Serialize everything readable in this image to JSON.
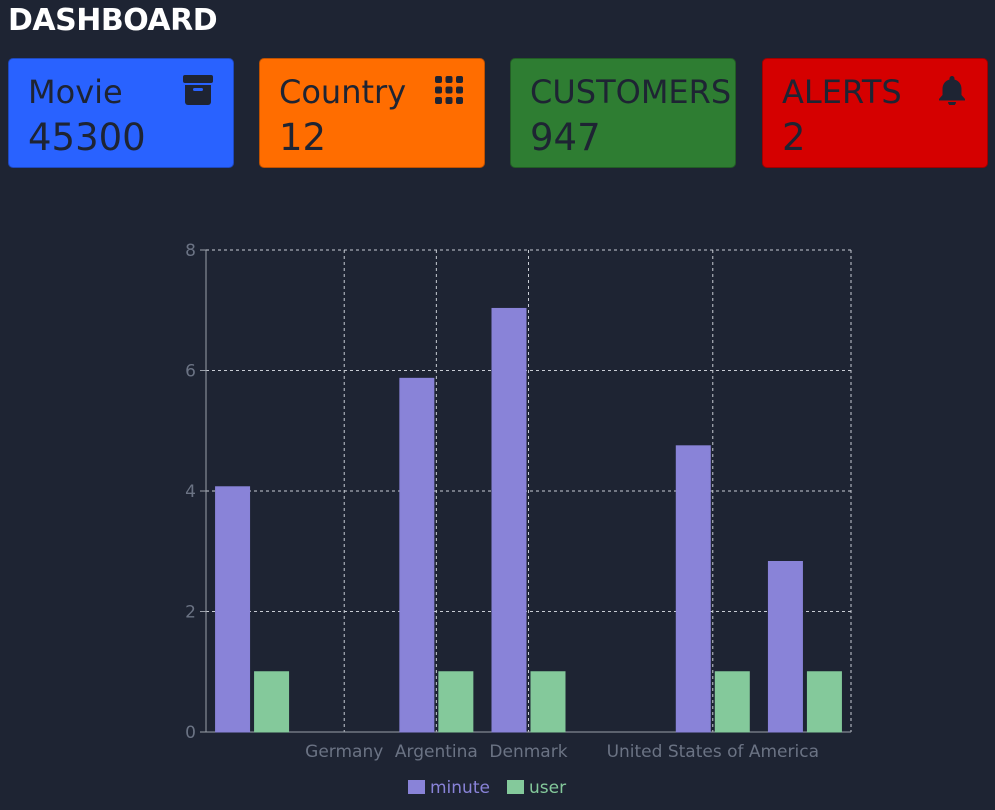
{
  "header": {
    "title": "DASHBOARD"
  },
  "cards": [
    {
      "label": "Movie",
      "value": "45300",
      "icon": "archive-box-icon",
      "color": "#2962ff"
    },
    {
      "label": "Country",
      "value": "12",
      "icon": "grid-dots-icon",
      "color": "#ff6d00"
    },
    {
      "label": "CUSTOMERS",
      "value": "947",
      "icon": "",
      "color": "#2e7d32"
    },
    {
      "label": "ALERTS",
      "value": "2",
      "icon": "bell-icon",
      "color": "#d50000"
    }
  ],
  "chart_data": {
    "type": "bar",
    "categories": [
      "",
      "Germany",
      "Argentina",
      "Denmark",
      "",
      "United States of America",
      ""
    ],
    "series": [
      {
        "name": "minute",
        "color": "#8983d8",
        "values": [
          4.07,
          0,
          5.87,
          7.03,
          0,
          4.75,
          2.83
        ]
      },
      {
        "name": "user",
        "color": "#84c99b",
        "values": [
          1,
          0,
          1,
          1,
          0,
          1,
          1
        ]
      }
    ],
    "ylim": [
      0,
      8
    ],
    "yticks": [
      "0",
      "2",
      "4",
      "6",
      "8"
    ],
    "grid": true,
    "legend": "bottom-center"
  }
}
